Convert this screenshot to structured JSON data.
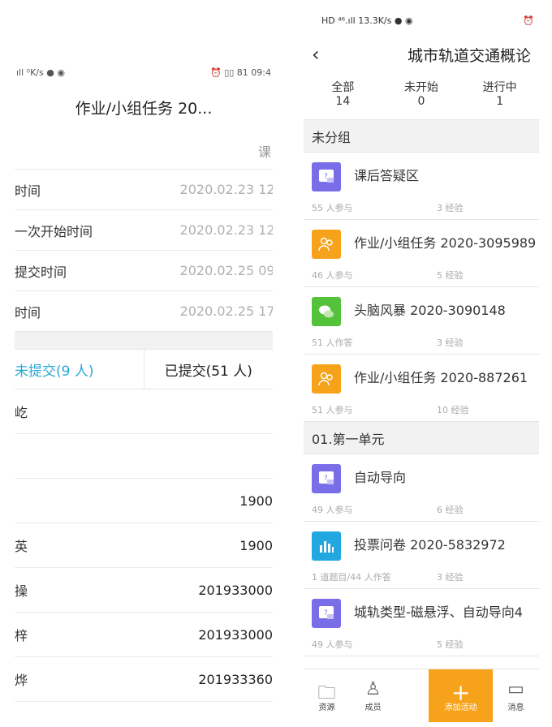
{
  "left": {
    "status": {
      "left": "ıll ⁰K/s ● ◉",
      "right": "⏰ ▯▯ 81 09:4"
    },
    "title": "作业/小组任务 20...",
    "course_label": "课",
    "rows": [
      {
        "label": "时间",
        "value": "2020.02.23 12:"
      },
      {
        "label": "一次开始时间",
        "value": "2020.02.23 12:"
      },
      {
        "label": "提交时间",
        "value": "2020.02.25 09:"
      },
      {
        "label": "时间",
        "value": "2020.02.25 17:"
      }
    ],
    "tabs": {
      "not_submitted": "未提交(9 人)",
      "submitted": "已提交(51 人)"
    },
    "students": [
      {
        "name": "屹",
        "number": ""
      },
      {
        "name": "",
        "number": ""
      },
      {
        "name": "",
        "number": "1900"
      },
      {
        "name": "英",
        "number": "1900"
      },
      {
        "name": "操",
        "number": "201933000"
      },
      {
        "name": "梓",
        "number": "201933000"
      },
      {
        "name": "烨",
        "number": "201933360"
      }
    ]
  },
  "right": {
    "status": {
      "left": "HD ⁴⁶.ıll 13.3K/s ● ◉",
      "right": "⏰"
    },
    "title": "城市轨道交通概论",
    "back": "‹",
    "stats": [
      {
        "label": "全部",
        "count": "14"
      },
      {
        "label": "未开始",
        "count": "0"
      },
      {
        "label": "进行中",
        "count": "1"
      }
    ],
    "sections": [
      {
        "name": "未分组",
        "items": [
          {
            "name": "课后答疑区",
            "meta1": "55 人参与",
            "meta2": "3 经验",
            "color": "#7a6ee8",
            "icon": "qa-icon"
          },
          {
            "name": "作业/小组任务 2020-3095989",
            "meta1": "46 人参与",
            "meta2": "5 经验",
            "color": "#f7a21b",
            "icon": "group-task-icon"
          },
          {
            "name": "头脑风暴 2020-3090148",
            "meta1": "51 人作答",
            "meta2": "3 经验",
            "color": "#55c23c",
            "icon": "brainstorm-icon"
          },
          {
            "name": "作业/小组任务 2020-887261",
            "meta1": "51 人参与",
            "meta2": "10 经验",
            "color": "#f7a21b",
            "icon": "group-task-icon"
          }
        ]
      },
      {
        "name": "01.第一单元",
        "items": [
          {
            "name": "自动导向",
            "meta1": "49 人参与",
            "meta2": "6 经验",
            "color": "#7a6ee8",
            "icon": "qa-icon"
          },
          {
            "name": "投票问卷 2020-5832972",
            "meta1": "1 道题目/44 人作答",
            "meta2": "3 经验",
            "color": "#23a7e0",
            "icon": "poll-icon"
          },
          {
            "name": "城轨类型-磁悬浮、自动导向4",
            "meta1": "49 人参与",
            "meta2": "5 经验",
            "color": "#7a6ee8",
            "icon": "qa-icon"
          }
        ]
      }
    ],
    "bottom": {
      "resources": "资源",
      "members": "成员",
      "add": "添加活动",
      "messages": "消息"
    }
  }
}
